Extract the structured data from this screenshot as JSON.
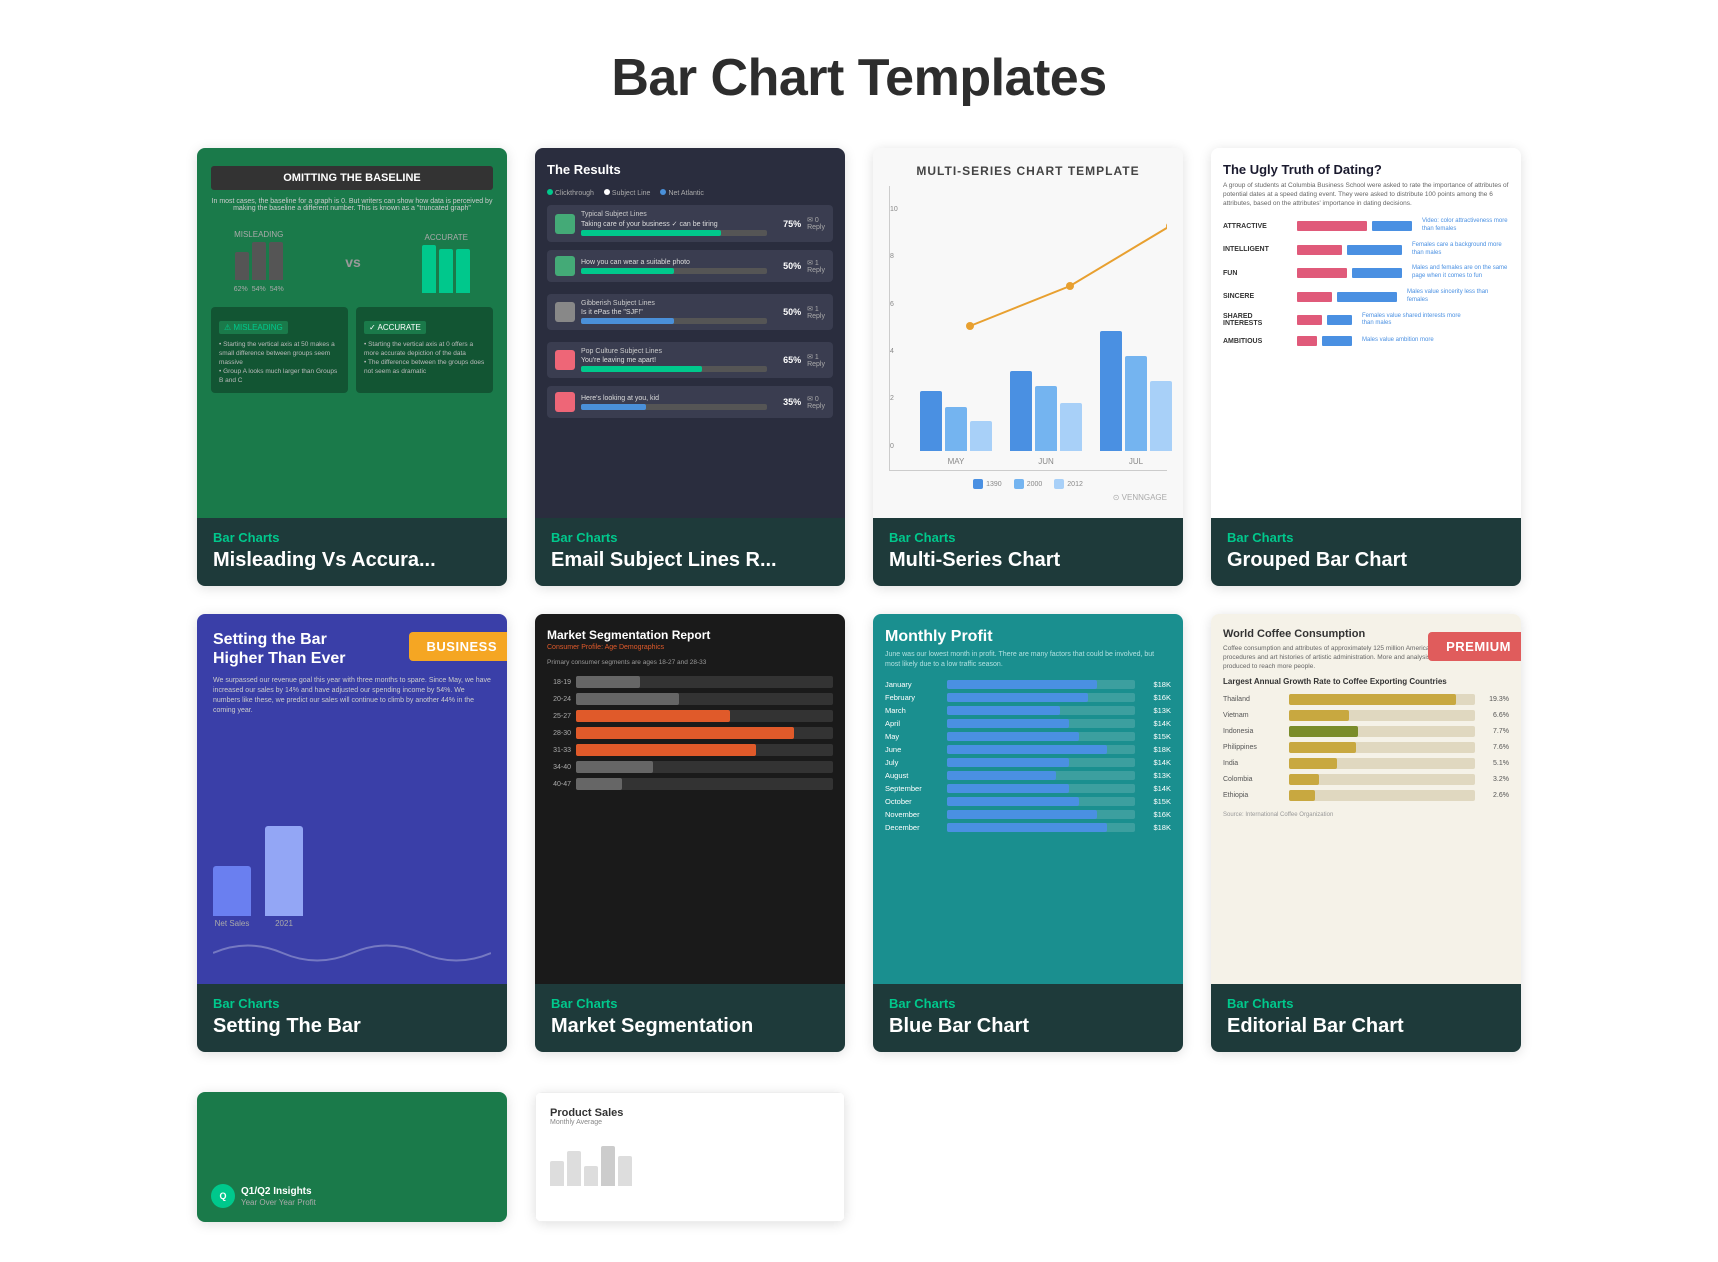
{
  "page": {
    "title": "Bar Chart Templates"
  },
  "cards": [
    {
      "id": "misleading",
      "category": "Bar Charts",
      "name": "Misleading Vs Accura...",
      "badge": null,
      "thumb_type": "misleading"
    },
    {
      "id": "email",
      "category": "Bar Charts",
      "name": "Email Subject Lines R...",
      "badge": null,
      "thumb_type": "email"
    },
    {
      "id": "multiseries",
      "category": "Bar Charts",
      "name": "Multi-Series Chart",
      "badge": null,
      "thumb_type": "multiseries"
    },
    {
      "id": "dating",
      "category": "Bar Charts",
      "name": "Grouped Bar Chart",
      "badge": null,
      "thumb_type": "dating"
    },
    {
      "id": "setting",
      "category": "Bar Charts",
      "name": "Setting The Bar",
      "badge": "BUSINESS",
      "badge_type": "business",
      "thumb_type": "setting"
    },
    {
      "id": "market",
      "category": "Bar Charts",
      "name": "Market Segmentation",
      "badge": null,
      "thumb_type": "market"
    },
    {
      "id": "monthly",
      "category": "Bar Charts",
      "name": "Blue Bar Chart",
      "badge": null,
      "thumb_type": "monthly"
    },
    {
      "id": "editorial",
      "category": "Bar Charts",
      "name": "Editorial Bar Chart",
      "badge": "PREMIUM",
      "badge_type": "premium",
      "thumb_type": "coffee"
    }
  ],
  "partial_cards": [
    {
      "id": "q1",
      "thumb_type": "q1",
      "title": "Q1/Q2 Insights",
      "sub": "Year Over Year Profit"
    },
    {
      "id": "product",
      "thumb_type": "product",
      "title": "Product Sales",
      "sub": "Monthly Average"
    }
  ]
}
